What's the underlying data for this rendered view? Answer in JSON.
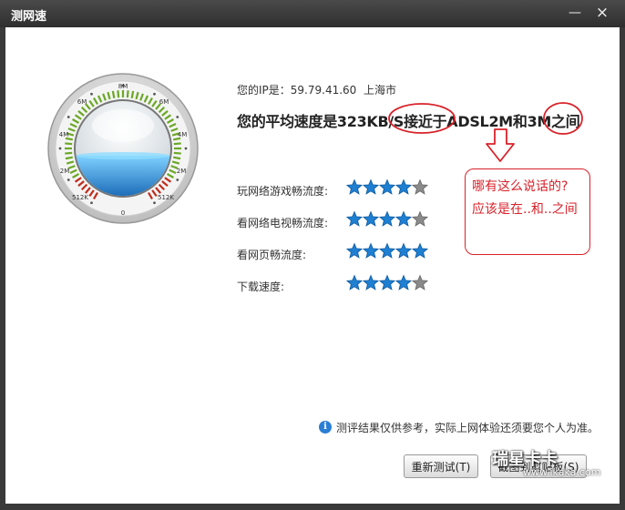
{
  "window": {
    "title": "测网速",
    "minimize_glyph": "—",
    "close_glyph": "×"
  },
  "gauge": {
    "labels": {
      "top": "8M",
      "left_upper": "6M",
      "right_upper": "6M",
      "left_mid": "4M",
      "right_mid": "4M",
      "left_low": "2M",
      "right_low": "2M",
      "left_bottom": "512K",
      "right_bottom": "512K",
      "bottom": "0"
    },
    "colors": {
      "water": "#2f9be4",
      "scale_green": "#6aa826",
      "scale_red": "#c02b1a"
    }
  },
  "info": {
    "ip_text": "您的IP是：59.79.41.60",
    "city": "上海市",
    "headline": "您的平均速度是323KB/S接近于ADSL2M和3M之间"
  },
  "ratings": [
    {
      "label": "玩网络游戏畅流度:",
      "stars": 4,
      "max": 5
    },
    {
      "label": "看网络电视畅流度:",
      "stars": 4,
      "max": 5
    },
    {
      "label": "看网页畅流度:",
      "stars": 5,
      "max": 5
    },
    {
      "label": "下载速度:",
      "stars": 4,
      "max": 5
    }
  ],
  "annotation": {
    "line1": "哪有这么说话的?",
    "line2": "应该是在..和..之间",
    "color": "#d8222a"
  },
  "note": {
    "icon": "info-icon",
    "text": "测评结果仅供参考，实际上网体验还须要您个人为准。"
  },
  "buttons": {
    "retest": "重新测试(T)",
    "copy": "截图到剪贴板(S)"
  },
  "watermark": {
    "brand": "瑞星卡卡",
    "url": "www.ikaka.com"
  },
  "colors": {
    "star_blue": "#1f7fd1",
    "star_gray": "#8a8a8a"
  }
}
